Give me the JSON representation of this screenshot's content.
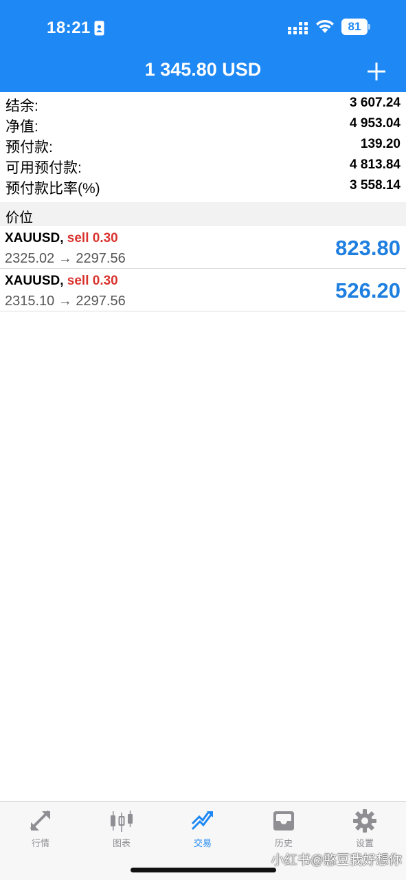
{
  "status_bar": {
    "time": "18:21",
    "battery": "81"
  },
  "header": {
    "title": "1 345.80 USD",
    "add_label": "+"
  },
  "summary": [
    {
      "label": "结余:",
      "value": "3 607.24"
    },
    {
      "label": "净值:",
      "value": "4 953.04"
    },
    {
      "label": "预付款:",
      "value": "139.20"
    },
    {
      "label": "可用预付款:",
      "value": "4 813.84"
    },
    {
      "label": "预付款比率(%)",
      "value": "3 558.14"
    }
  ],
  "positions_section": "价位",
  "positions": [
    {
      "symbol": "XAUUSD,",
      "side": "sell 0.30",
      "prices": "2325.02 → 2297.56",
      "profit": "823.80"
    },
    {
      "symbol": "XAUUSD,",
      "side": "sell 0.30",
      "prices": "2315.10 → 2297.56",
      "profit": "526.20"
    }
  ],
  "tabs": [
    {
      "label": "行情",
      "icon": "quotes-icon",
      "active": false
    },
    {
      "label": "图表",
      "icon": "chart-icon",
      "active": false
    },
    {
      "label": "交易",
      "icon": "trade-icon",
      "active": true
    },
    {
      "label": "历史",
      "icon": "history-icon",
      "active": false
    },
    {
      "label": "设置",
      "icon": "settings-icon",
      "active": false
    }
  ],
  "watermark": "小红书@憨豆我好想你",
  "colors": {
    "header_bg": "#1e88f5",
    "sell": "#d9322d",
    "profit": "#1e7fe0",
    "tab_active": "#1e88f5",
    "tab_inactive": "#8e8e93"
  }
}
